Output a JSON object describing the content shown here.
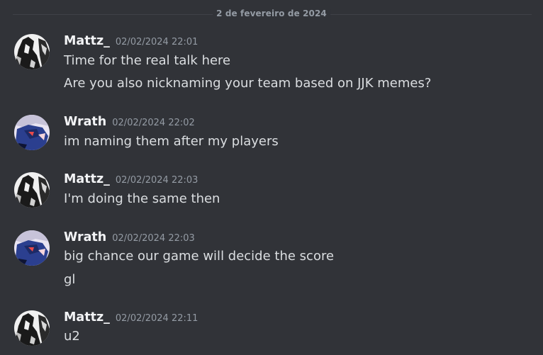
{
  "date_divider": "2 de fevereiro de 2024",
  "colors": {
    "background": "#313338",
    "username": "#f2f3f5",
    "timestamp": "#949ba4",
    "message_text": "#dbdee1",
    "divider": "#3f4147"
  },
  "messages": [
    {
      "author": "Mattz_",
      "avatar": "mattz-avatar",
      "timestamp": "02/02/2024 22:01",
      "lines": [
        "Time for the real talk here",
        "Are you also nicknaming your team based on JJK memes?"
      ]
    },
    {
      "author": "Wrath",
      "avatar": "wrath-avatar",
      "timestamp": "02/02/2024 22:02",
      "lines": [
        "im naming them after my players"
      ]
    },
    {
      "author": "Mattz_",
      "avatar": "mattz-avatar",
      "timestamp": "02/02/2024 22:03",
      "lines": [
        "I'm doing the same then"
      ]
    },
    {
      "author": "Wrath",
      "avatar": "wrath-avatar",
      "timestamp": "02/02/2024 22:03",
      "lines": [
        "big chance our game will decide the score",
        "gl"
      ]
    },
    {
      "author": "Mattz_",
      "avatar": "mattz-avatar",
      "timestamp": "02/02/2024 22:11",
      "lines": [
        "u2"
      ]
    }
  ]
}
